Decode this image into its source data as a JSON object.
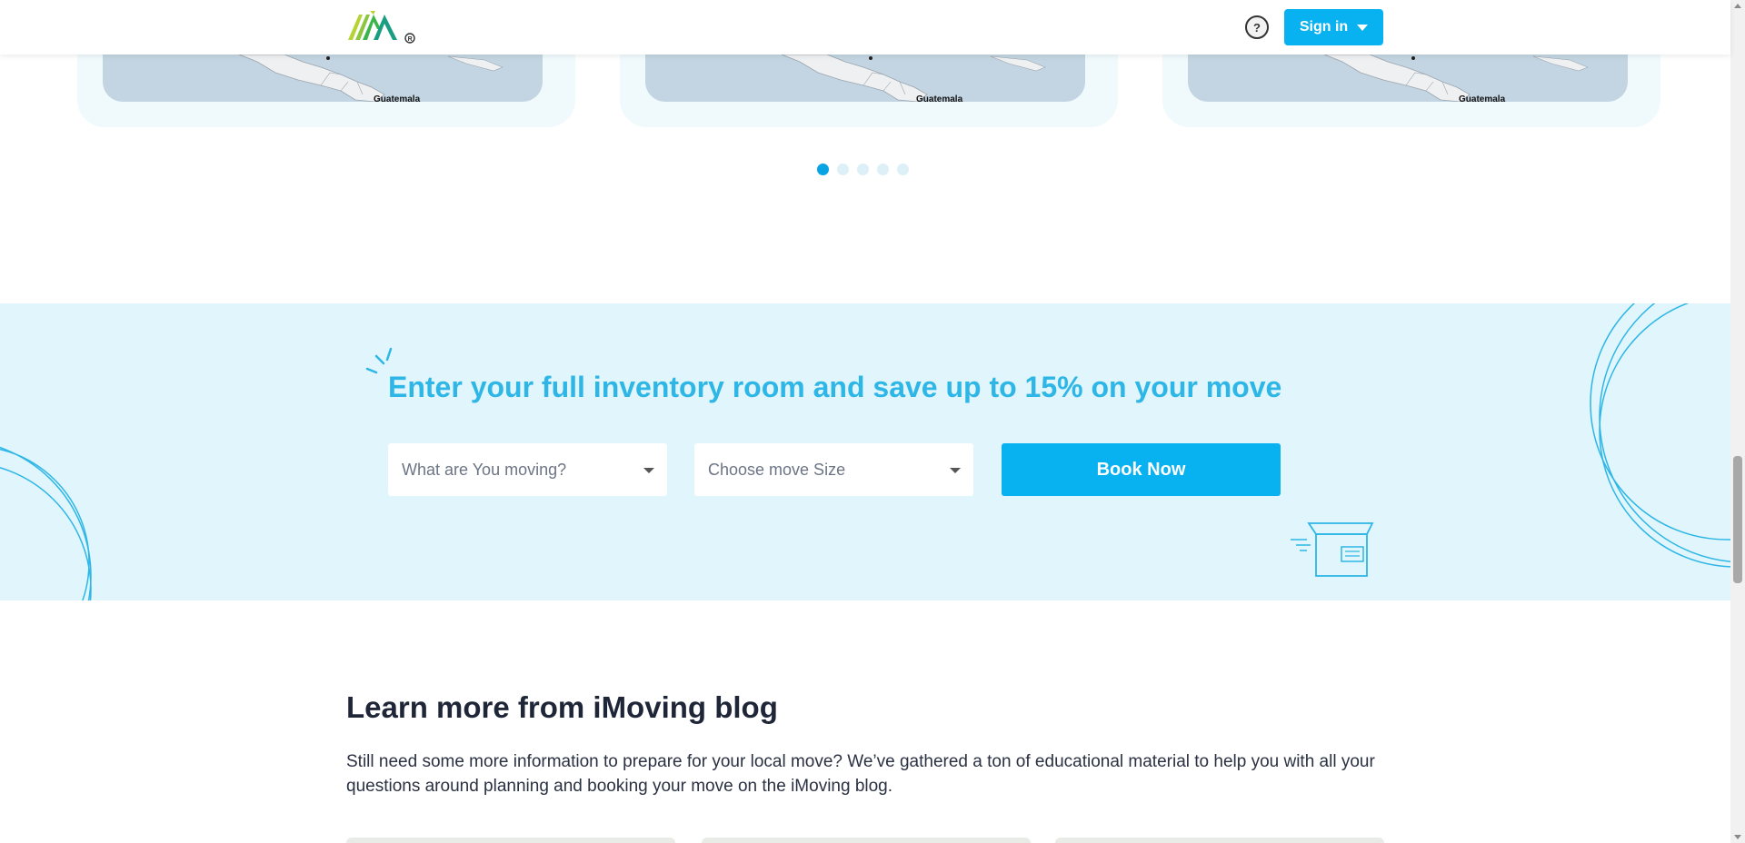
{
  "header": {
    "logo_alt": "iMoving",
    "help_icon_glyph": "?",
    "signin_label": "Sign in"
  },
  "map_cards": [
    {
      "city_label": "Guatemala"
    },
    {
      "city_label": "Guatemala"
    },
    {
      "city_label": "Guatemala"
    }
  ],
  "carousel": {
    "dot_count": 5,
    "active_index": 0
  },
  "promo": {
    "title": "Enter your full inventory room and save up to 15% on your move",
    "moving_select_placeholder": "What are You moving?",
    "size_select_placeholder": "Choose move Size",
    "book_button_label": "Book Now"
  },
  "blog": {
    "title": "Learn more from iMoving blog",
    "description": "Still need some more information to prepare for your local move? We’ve gathered a ton of educational material to help you with all your questions around planning and booking your move on the iMoving blog."
  },
  "colors": {
    "accent": "#08b1ef",
    "promo_bg": "#e0f5fc",
    "promo_title": "#2eb6e6",
    "heading": "#1e2638"
  },
  "icons": [
    "help-headset-icon",
    "chevron-down-icon",
    "dropdown-arrow-icon",
    "box-icon",
    "burst-icon"
  ]
}
